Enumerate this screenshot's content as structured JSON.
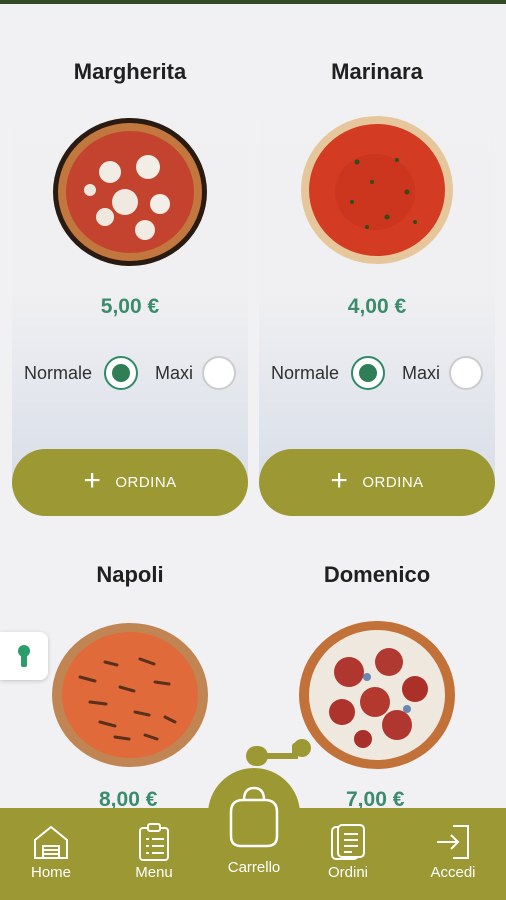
{
  "menu": {
    "items": [
      {
        "name": "Margherita",
        "price": "5,00 €",
        "size_normal": "Normale",
        "size_maxi": "Maxi",
        "selected": "Normale",
        "order_label": "ORDINA"
      },
      {
        "name": "Marinara",
        "price": "4,00 €",
        "size_normal": "Normale",
        "size_maxi": "Maxi",
        "selected": "Normale",
        "order_label": "ORDINA"
      },
      {
        "name": "Napoli",
        "price": "8,00 €"
      },
      {
        "name": "Domenico",
        "price": "7,00 €"
      }
    ]
  },
  "nav": {
    "home": "Home",
    "menu": "Menu",
    "cart": "Carrello",
    "orders": "Ordini",
    "login": "Accedi"
  },
  "colors": {
    "accent": "#9c9834",
    "price": "#3b8c6d",
    "radio_checked": "#2f7e56"
  }
}
